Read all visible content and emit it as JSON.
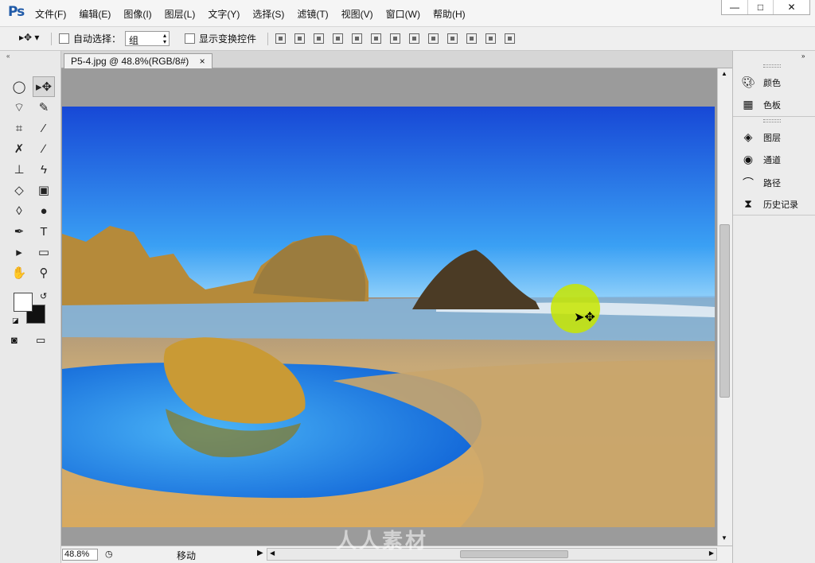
{
  "app": {
    "logo": "Ps"
  },
  "menu": [
    "文件(F)",
    "编辑(E)",
    "图像(I)",
    "图层(L)",
    "文字(Y)",
    "选择(S)",
    "滤镜(T)",
    "视图(V)",
    "窗口(W)",
    "帮助(H)"
  ],
  "window_controls": {
    "minimize_icon": "minimize-icon",
    "maximize_icon": "maximize-icon",
    "close_icon": "close-icon"
  },
  "options": {
    "auto_select_label": "自动选择：",
    "group_value": "组",
    "show_transform_label": "显示变换控件"
  },
  "document": {
    "tab_title": "P5-4.jpg @ 48.8%(RGB/8#)",
    "zoom": "48.8%",
    "mode": "移动"
  },
  "right_panel": {
    "items": [
      {
        "label": "颜色",
        "icon": "color-palette-icon"
      },
      {
        "label": "色板",
        "icon": "swatches-icon"
      },
      {
        "label": "图层",
        "icon": "layers-icon"
      },
      {
        "label": "通道",
        "icon": "channels-icon"
      },
      {
        "label": "路径",
        "icon": "paths-icon"
      },
      {
        "label": "历史记录",
        "icon": "history-icon"
      }
    ]
  },
  "watermark": "人人素材",
  "colors": {
    "foreground": "#ffffff",
    "background": "#111111",
    "accent": "#1f5aa8"
  }
}
